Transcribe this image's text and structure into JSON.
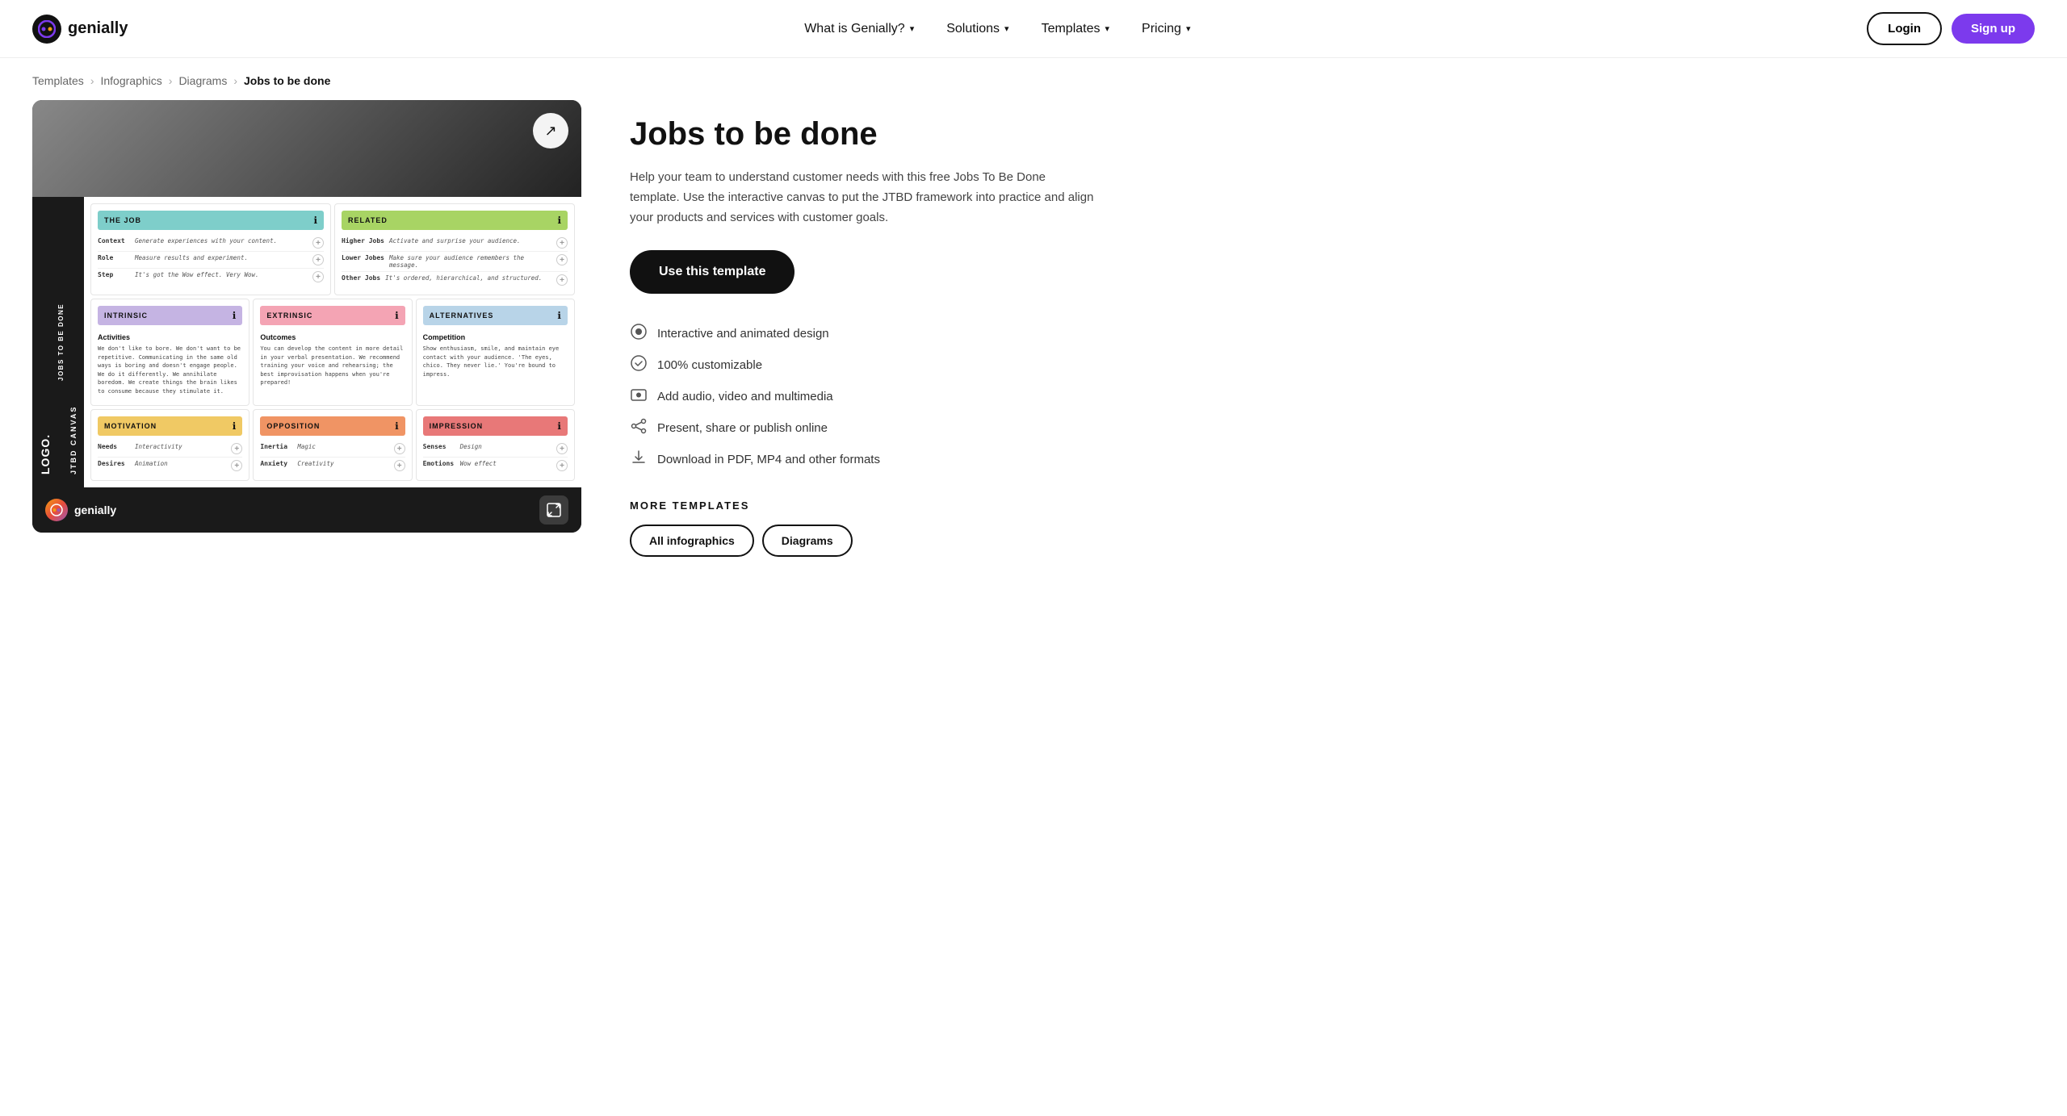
{
  "nav": {
    "logo_text": "genially",
    "links": [
      {
        "label": "What is Genially?",
        "id": "what-is"
      },
      {
        "label": "Solutions",
        "id": "solutions"
      },
      {
        "label": "Templates",
        "id": "templates"
      },
      {
        "label": "Pricing",
        "id": "pricing"
      }
    ],
    "login_label": "Login",
    "signup_label": "Sign up"
  },
  "breadcrumb": {
    "items": [
      {
        "label": "Templates",
        "href": "#"
      },
      {
        "label": "Infographics",
        "href": "#"
      },
      {
        "label": "Diagrams",
        "href": "#"
      },
      {
        "label": "Jobs to be done",
        "current": true
      }
    ]
  },
  "preview": {
    "canvas_sidebar_top": "JTBD CANVAS",
    "canvas_sidebar_mid": "JOBS TO BE DONE",
    "canvas_sidebar_bottom": "LOGO.",
    "brand_text": "genially",
    "cards": {
      "the_job": {
        "header": "THE JOB",
        "rows": [
          {
            "label": "Context",
            "value": "Generate experiences with your content.",
            "plus": "+"
          },
          {
            "label": "Role",
            "value": "Measure results and experiment.",
            "plus": "+"
          },
          {
            "label": "Step",
            "value": "It's got the Wow effect. Very Wow.",
            "plus": "+"
          }
        ]
      },
      "related": {
        "header": "RELATED",
        "rows": [
          {
            "label": "Higher Jobs",
            "value": "Activate and surprise your audience.",
            "plus": "+"
          },
          {
            "label": "Lower Jobes",
            "value": "Make sure your audience remembers the message.",
            "plus": "+"
          },
          {
            "label": "Other Jobs",
            "value": "It's ordered, hierarchical, and structured.",
            "plus": "+"
          }
        ]
      },
      "intrinsic": {
        "header": "INTRINSIC",
        "activity_title": "Activities",
        "activity_text": "We don't like to bore. We don't want to be repetitive. Communicating in the same old ways is boring and doesn't engage people. We do it differently. We annihilate boredom. We create things the brain likes to consume because they stimulate it."
      },
      "extrinsic": {
        "header": "EXTRINSIC",
        "activity_title": "Outcomes",
        "activity_text": "You can develop the content in more detail in your verbal presentation. We recommend training your voice and rehearsing; the best improvisation happens when you're prepared!"
      },
      "alternatives": {
        "header": "ALTERNATIVES",
        "activity_title": "Competition",
        "activity_text": "Show enthusiasm, smile, and maintain eye contact with your audience. 'The eyes, chico. They never lie.' You're bound to impress."
      },
      "motivation": {
        "header": "MOTIVATION",
        "rows": [
          {
            "label": "Needs",
            "value": "Interactivity",
            "plus": "+"
          },
          {
            "label": "Desires",
            "value": "Animation",
            "plus": "+"
          }
        ]
      },
      "opposition": {
        "header": "OPPOSITION",
        "rows": [
          {
            "label": "Inertia",
            "value": "Magic",
            "plus": "+"
          },
          {
            "label": "Anxiety",
            "value": "Creativity",
            "plus": "+"
          }
        ]
      },
      "impression": {
        "header": "IMPRESSION",
        "rows": [
          {
            "label": "Senses",
            "value": "Design",
            "plus": "+"
          },
          {
            "label": "Emotions",
            "value": "Wow effect",
            "plus": "+"
          }
        ]
      }
    }
  },
  "info": {
    "title": "Jobs to be done",
    "description": "Help your team to understand customer needs with this free Jobs To Be Done template. Use the interactive canvas to put the JTBD framework into practice and align your products and services with customer goals.",
    "use_template_label": "Use this template",
    "features": [
      {
        "icon": "🎨",
        "text": "Interactive and animated design"
      },
      {
        "icon": "⚙️",
        "text": "100% customizable"
      },
      {
        "icon": "🎬",
        "text": "Add audio, video and multimedia"
      },
      {
        "icon": "🔗",
        "text": "Present, share or publish online"
      },
      {
        "icon": "💾",
        "text": "Download in PDF, MP4 and other formats"
      }
    ],
    "more_templates_label": "MORE TEMPLATES",
    "template_tags": [
      {
        "label": "All infographics"
      },
      {
        "label": "Diagrams"
      }
    ]
  }
}
